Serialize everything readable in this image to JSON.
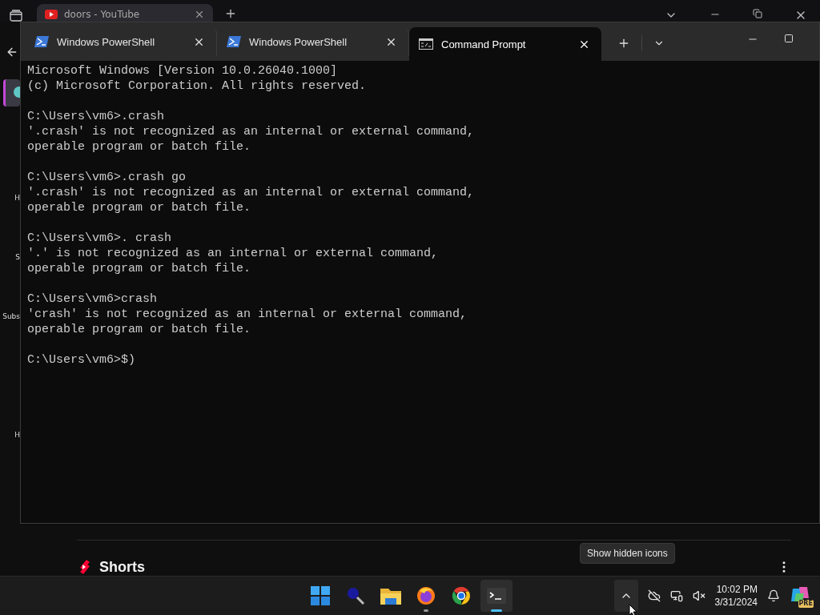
{
  "browser": {
    "tab": {
      "title": "doors - YouTube"
    },
    "sidebar_items": [
      "H",
      "S",
      "Subs",
      "H"
    ],
    "section": {
      "title": "Shorts"
    }
  },
  "terminal": {
    "tabs": [
      {
        "title": "Windows PowerShell",
        "kind": "powershell",
        "selected": false
      },
      {
        "title": "Windows PowerShell",
        "kind": "powershell",
        "selected": false
      },
      {
        "title": "Command Prompt",
        "kind": "cmd",
        "selected": true
      }
    ],
    "blocks": [
      [
        "Microsoft Windows [Version 10.0.26040.1000]",
        "(c) Microsoft Corporation. All rights reserved."
      ],
      [
        "C:\\Users\\vm6>.crash",
        "'.crash' is not recognized as an internal or external command,",
        "operable program or batch file."
      ],
      [
        "C:\\Users\\vm6>.crash go",
        "'.crash' is not recognized as an internal or external command,",
        "operable program or batch file."
      ],
      [
        "C:\\Users\\vm6>. crash",
        "'.' is not recognized as an internal or external command,",
        "operable program or batch file."
      ],
      [
        "C:\\Users\\vm6>crash",
        "'crash' is not recognized as an internal or external command,",
        "operable program or batch file."
      ],
      [
        "C:\\Users\\vm6>$)"
      ]
    ]
  },
  "taskbar": {
    "apps": [
      {
        "kind": "start",
        "running": false,
        "active": false
      },
      {
        "kind": "search",
        "running": false,
        "active": false
      },
      {
        "kind": "files",
        "running": false,
        "active": false
      },
      {
        "kind": "firefox",
        "running": true,
        "active": false
      },
      {
        "kind": "chrome",
        "running": false,
        "active": false
      },
      {
        "kind": "terminal",
        "running": true,
        "active": true
      }
    ],
    "tooltip": "Show hidden icons",
    "clock": {
      "time": "10:02 PM",
      "date": "3/31/2024"
    },
    "copilot_badge": "PRE"
  }
}
